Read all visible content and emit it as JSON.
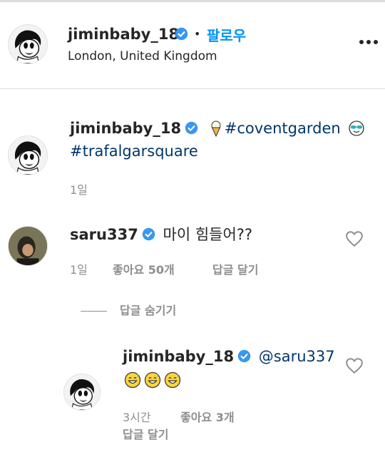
{
  "header": {
    "username": "jiminbaby_18",
    "dot": "•",
    "follow_label": "팔로우",
    "location": "London, United Kingdom",
    "more_label": "..."
  },
  "caption": {
    "username": "jiminbaby_18",
    "tag1": "#coventgarden",
    "tag2": "#trafalgarsquare",
    "time": "1일",
    "emoji_icons": [
      "ice-cream-icon",
      "smiling-face-sunglasses-icon"
    ]
  },
  "comment": {
    "username": "saru337",
    "text": "마이 힘들어??",
    "time": "1일",
    "likes": "좋아요 50개",
    "reply_label": "답글 달기"
  },
  "replies_toggle": {
    "label": "답글 숨기기"
  },
  "reply": {
    "username": "jiminbaby_18",
    "mention": "@saru337",
    "emoji_icons": [
      "grinning-sweat-icon",
      "grinning-sweat-icon",
      "grinning-sweat-icon"
    ],
    "time": "3시간",
    "likes": "좋아요 3개",
    "reply_label": "답글 달기"
  },
  "colors": {
    "link": "#00376b",
    "follow": "#0095f6",
    "verified": "#3897f0",
    "muted": "#8e8e8e",
    "text": "#262626"
  }
}
